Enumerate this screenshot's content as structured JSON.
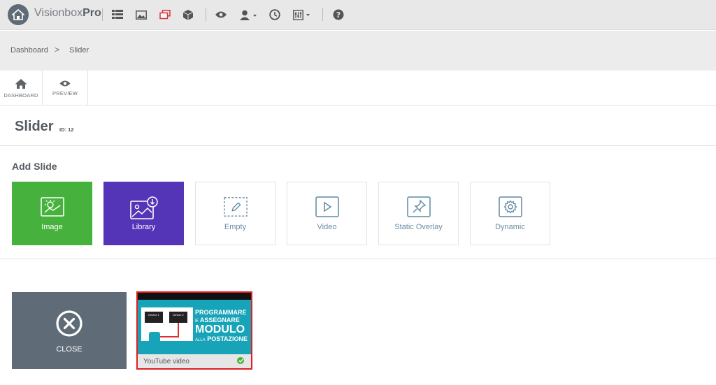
{
  "app": {
    "brand_light": "Visionbox",
    "brand_bold": "Pro"
  },
  "topbar_icons": [
    "home-icon",
    "list-icon",
    "image-icon",
    "slides-icon",
    "box-icon",
    "eye-icon",
    "user-icon",
    "clock-icon",
    "sliders-icon",
    "help-icon"
  ],
  "breadcrumb": {
    "item1": "Dashboard",
    "separator": ">",
    "item2": "Slider"
  },
  "toolbar": {
    "dashboard_label": "DASHBOARD",
    "preview_label": "PREVIEW"
  },
  "page": {
    "title": "Slider",
    "id_label": "ID: 12"
  },
  "add_slide": {
    "heading": "Add Slide",
    "types": [
      {
        "label": "Image",
        "icon": "image-icon"
      },
      {
        "label": "Library",
        "icon": "library-icon"
      },
      {
        "label": "Empty",
        "icon": "edit-icon"
      },
      {
        "label": "Video",
        "icon": "play-icon"
      },
      {
        "label": "Static Overlay",
        "icon": "pin-icon"
      },
      {
        "label": "Dynamic",
        "icon": "gear-icon"
      }
    ]
  },
  "slides": {
    "close_label": "CLOSE",
    "video": {
      "caption": "YouTube video",
      "thumb_device1": "Device 1",
      "thumb_device2": "Device 2",
      "thumb_line1": "PROGRAMMARE",
      "thumb_line2_small": "E",
      "thumb_line2": "ASSEGNARE",
      "thumb_line3": "MODULO",
      "thumb_line4_small": "ALLA",
      "thumb_line4": "POSTAZIONE"
    }
  },
  "colors": {
    "image_card": "#46b23d",
    "library_card": "#5535b7",
    "close_tile": "#5f6c78",
    "selected_border": "#e01f1f",
    "thumb_teal": "#17a3b8"
  }
}
